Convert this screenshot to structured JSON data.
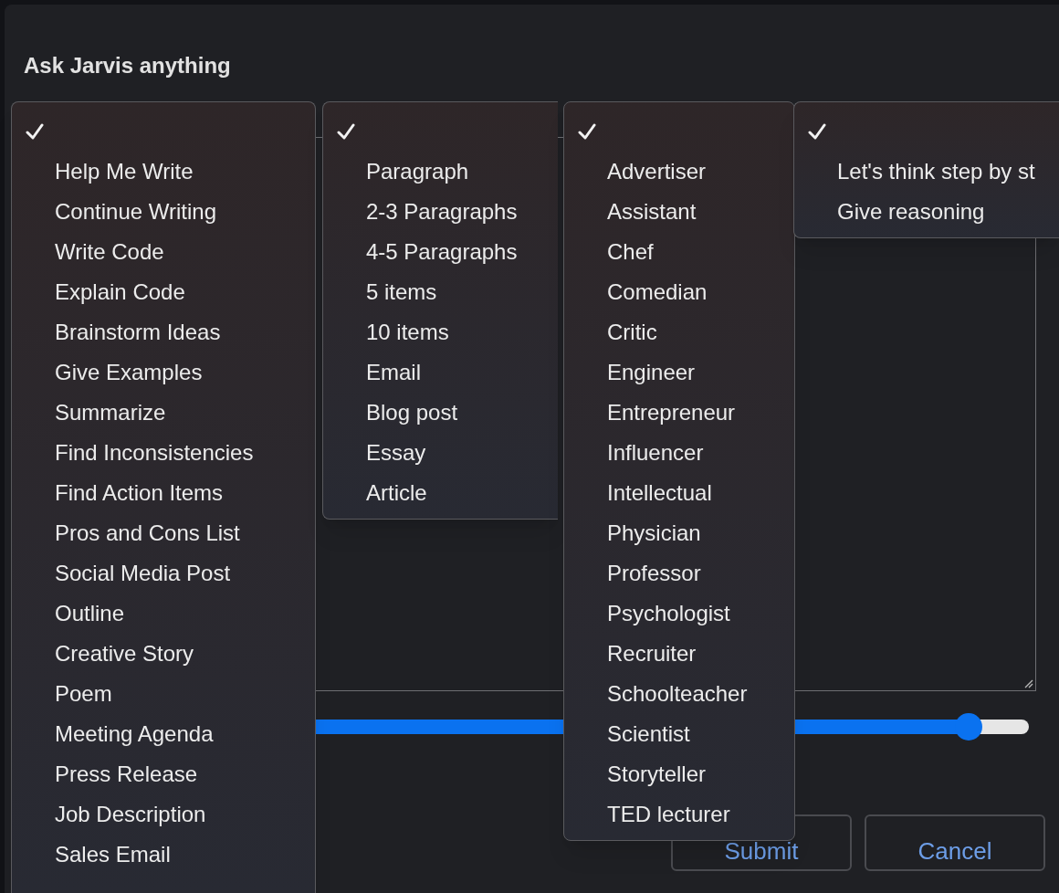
{
  "dialog": {
    "title": "Ask Jarvis anything"
  },
  "prompt": {
    "slider": {
      "level": 0.94
    }
  },
  "buttons": [
    {
      "label": "Submit"
    },
    {
      "label": "Cancel"
    }
  ],
  "menus": [
    {
      "items": [
        {
          "selected": true
        },
        {
          "label": "Help Me Write",
          "selected": false
        },
        {
          "label": "Continue Writing",
          "selected": false
        },
        {
          "label": "Write Code",
          "selected": false
        },
        {
          "label": "Explain Code",
          "selected": false
        },
        {
          "label": "Brainstorm Ideas",
          "selected": false
        },
        {
          "label": "Give Examples",
          "selected": false
        },
        {
          "label": "Summarize",
          "selected": false
        },
        {
          "label": "Find Inconsistencies",
          "selected": false
        },
        {
          "label": "Find Action Items",
          "selected": false
        },
        {
          "label": "Pros and Cons List",
          "selected": false
        },
        {
          "label": "Social Media Post",
          "selected": false
        },
        {
          "label": "Outline",
          "selected": false
        },
        {
          "label": "Creative Story",
          "selected": false
        },
        {
          "label": "Poem",
          "selected": false
        },
        {
          "label": "Meeting Agenda",
          "selected": false
        },
        {
          "label": "Press Release",
          "selected": false
        },
        {
          "label": "Job Description",
          "selected": false
        },
        {
          "label": "Sales Email",
          "selected": false
        }
      ]
    },
    {
      "items": [
        {
          "selected": true
        },
        {
          "label": "Paragraph",
          "selected": false
        },
        {
          "label": "2-3 Paragraphs",
          "selected": false
        },
        {
          "label": "4-5 Paragraphs",
          "selected": false
        },
        {
          "label": "5 items",
          "selected": false
        },
        {
          "label": "10 items",
          "selected": false
        },
        {
          "label": "Email",
          "selected": false
        },
        {
          "label": "Blog post",
          "selected": false
        },
        {
          "label": "Essay",
          "selected": false
        },
        {
          "label": "Article",
          "selected": false
        }
      ]
    },
    {
      "items": [
        {
          "selected": true
        },
        {
          "label": "Advertiser",
          "selected": false
        },
        {
          "label": "Assistant",
          "selected": false
        },
        {
          "label": "Chef",
          "selected": false
        },
        {
          "label": "Comedian",
          "selected": false
        },
        {
          "label": "Critic",
          "selected": false
        },
        {
          "label": "Engineer",
          "selected": false
        },
        {
          "label": "Entrepreneur",
          "selected": false
        },
        {
          "label": "Influencer",
          "selected": false
        },
        {
          "label": "Intellectual",
          "selected": false
        },
        {
          "label": "Physician",
          "selected": false
        },
        {
          "label": "Professor",
          "selected": false
        },
        {
          "label": "Psychologist",
          "selected": false
        },
        {
          "label": "Recruiter",
          "selected": false
        },
        {
          "label": "Schoolteacher",
          "selected": false
        },
        {
          "label": "Scientist",
          "selected": false
        },
        {
          "label": "Storyteller",
          "selected": false
        },
        {
          "label": "TED lecturer",
          "selected": false
        }
      ]
    },
    {
      "items": [
        {
          "selected": true
        },
        {
          "label": "Let's think step by st",
          "selected": false
        },
        {
          "label": "Give reasoning",
          "selected": false
        }
      ]
    }
  ]
}
